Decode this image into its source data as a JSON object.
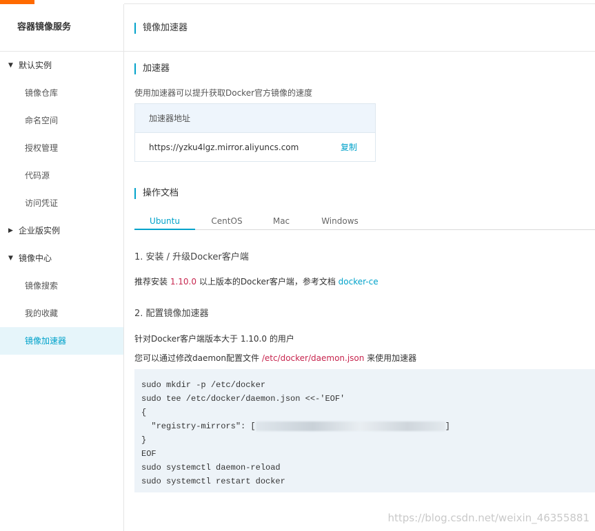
{
  "sidebar": {
    "title": "容器镜像服务",
    "groups": [
      {
        "label": "默认实例",
        "expanded": true,
        "items": [
          "镜像仓库",
          "命名空间",
          "授权管理",
          "代码源",
          "访问凭证"
        ]
      },
      {
        "label": "企业版实例",
        "expanded": false,
        "items": []
      },
      {
        "label": "镜像中心",
        "expanded": true,
        "items": [
          "镜像搜索",
          "我的收藏",
          "镜像加速器"
        ]
      }
    ],
    "active_item": "镜像加速器"
  },
  "header": {
    "title": "镜像加速器"
  },
  "accelerator": {
    "section_title": "加速器",
    "description": "使用加速器可以提升获取Docker官方镜像的速度",
    "table_header": "加速器地址",
    "address": "https://yzku4lgz.mirror.aliyuncs.com",
    "copy_label": "复制"
  },
  "docs": {
    "section_title": "操作文档",
    "tabs": [
      "Ubuntu",
      "CentOS",
      "Mac",
      "Windows"
    ],
    "active_tab": "Ubuntu",
    "step1": {
      "title": "1. 安装 / 升级Docker客户端",
      "text_before": "推荐安装 ",
      "version": "1.10.0",
      "text_middle": " 以上版本的Docker客户端，参考文档 ",
      "link": "docker-ce"
    },
    "step2": {
      "title": "2. 配置镜像加速器",
      "line1": "针对Docker客户端版本大于 1.10.0 的用户",
      "line2_before": "您可以通过修改daemon配置文件 ",
      "line2_path": "/etc/docker/daemon.json",
      "line2_after": " 来使用加速器"
    },
    "code": {
      "line1": "sudo mkdir -p /etc/docker",
      "line2": "sudo tee /etc/docker/daemon.json <<-'EOF'",
      "line3": "{",
      "line4_prefix": "  \"registry-mirrors\": [",
      "line4_suffix": "]",
      "line5": "}",
      "line6": "EOF",
      "line7": "sudo systemctl daemon-reload",
      "line8": "sudo systemctl restart docker"
    }
  },
  "watermark": "https://blog.csdn.net/weixin_46355881",
  "colors": {
    "accent": "#00a2ca",
    "brand": "#ff6a00",
    "highlight": "#c7254e"
  }
}
